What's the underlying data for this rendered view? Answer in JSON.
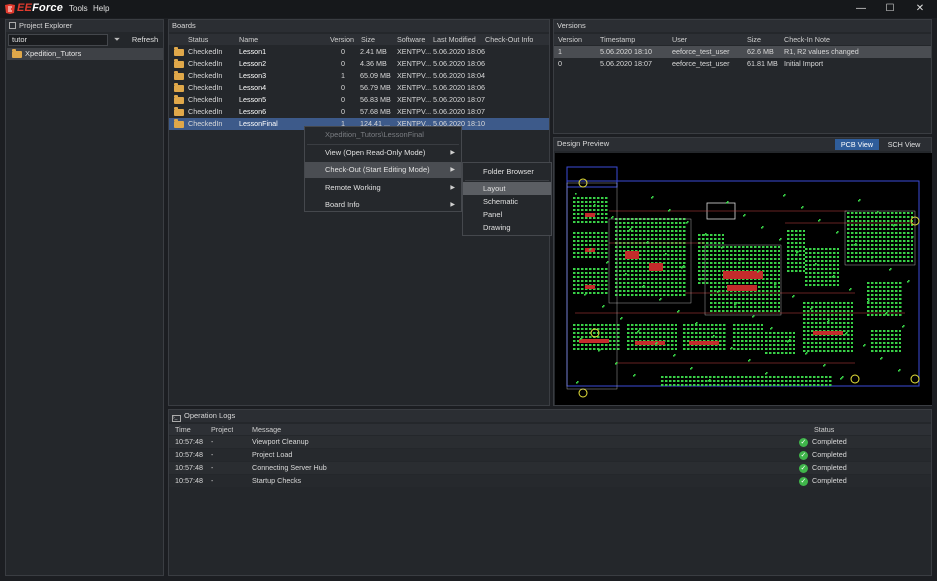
{
  "app": {
    "logo_e": "EE",
    "logo_rest": "Force",
    "menu": [
      "Tools",
      "Help"
    ],
    "win_minimize": "—",
    "win_maximize": "☐",
    "win_close": "✕"
  },
  "explorer": {
    "title": "Project Explorer",
    "search_value": "tutor",
    "refresh_label": "Refresh",
    "items": [
      "Xpedition_Tutors"
    ]
  },
  "boards": {
    "title": "Boards",
    "columns": [
      "Status",
      "Name",
      "Version",
      "Size",
      "Software",
      "Last Modified",
      "Check-Out Info"
    ],
    "rows": [
      {
        "status": "CheckedIn",
        "name": "Lesson1",
        "version": "0",
        "size": "2.41 MB",
        "software": "XENTPV...",
        "modified": "5.06.2020 18:06",
        "checkout": ""
      },
      {
        "status": "CheckedIn",
        "name": "Lesson2",
        "version": "0",
        "size": "4.36 MB",
        "software": "XENTPV...",
        "modified": "5.06.2020 18:06",
        "checkout": ""
      },
      {
        "status": "CheckedIn",
        "name": "Lesson3",
        "version": "1",
        "size": "65.09 MB",
        "software": "XENTPV...",
        "modified": "5.06.2020 18:04",
        "checkout": ""
      },
      {
        "status": "CheckedIn",
        "name": "Lesson4",
        "version": "0",
        "size": "56.79 MB",
        "software": "XENTPV...",
        "modified": "5.06.2020 18:06",
        "checkout": ""
      },
      {
        "status": "CheckedIn",
        "name": "Lesson5",
        "version": "0",
        "size": "56.83 MB",
        "software": "XENTPV...",
        "modified": "5.06.2020 18:07",
        "checkout": ""
      },
      {
        "status": "CheckedIn",
        "name": "Lesson6",
        "version": "0",
        "size": "57.68 MB",
        "software": "XENTPV...",
        "modified": "5.06.2020 18:07",
        "checkout": ""
      },
      {
        "status": "CheckedIn",
        "name": "LessonFinal",
        "version": "1",
        "size": "124.41 ...",
        "software": "XENTPV...",
        "modified": "5.06.2020 18:10",
        "checkout": ""
      }
    ]
  },
  "context_menu": {
    "header": "Xpedition_Tutors\\LessonFinal",
    "items": [
      "View (Open Read-Only Mode)",
      "Check-Out (Start Editing Mode)",
      "Remote Working",
      "Board Info"
    ],
    "submenu": [
      "Folder Browser",
      "Layout",
      "Schematic",
      "Panel",
      "Drawing"
    ]
  },
  "versions": {
    "title": "Versions",
    "columns": [
      "Version",
      "Timestamp",
      "User",
      "Size",
      "Check-In Note"
    ],
    "rows": [
      {
        "version": "1",
        "timestamp": "5.06.2020 18:10",
        "user": "eeforce_test_user",
        "size": "62.6 MB",
        "note": "R1, R2 values changed"
      },
      {
        "version": "0",
        "timestamp": "5.06.2020 18:07",
        "user": "eeforce_test_user",
        "size": "61.81 MB",
        "note": "Initial Import"
      }
    ]
  },
  "preview": {
    "title": "Design Preview",
    "tab_pcb": "PCB View",
    "tab_sch": "SCH View"
  },
  "logs": {
    "title": "Operation Logs",
    "columns": [
      "Time",
      "Project",
      "Message",
      "Status"
    ],
    "rows": [
      {
        "time": "10:57:48",
        "project": "-",
        "message": "Viewport Cleanup",
        "status": "Completed"
      },
      {
        "time": "10:57:48",
        "project": "-",
        "message": "Project Load",
        "status": "Completed"
      },
      {
        "time": "10:57:48",
        "project": "-",
        "message": "Connecting Server Hub",
        "status": "Completed"
      },
      {
        "time": "10:57:48",
        "project": "-",
        "message": "Startup Checks",
        "status": "Completed"
      }
    ]
  },
  "colors": {
    "accent": "#3d5a8a",
    "tab_active": "#2f5d9a",
    "status_ok": "#3fb54a",
    "folder": "#e0a84a"
  }
}
